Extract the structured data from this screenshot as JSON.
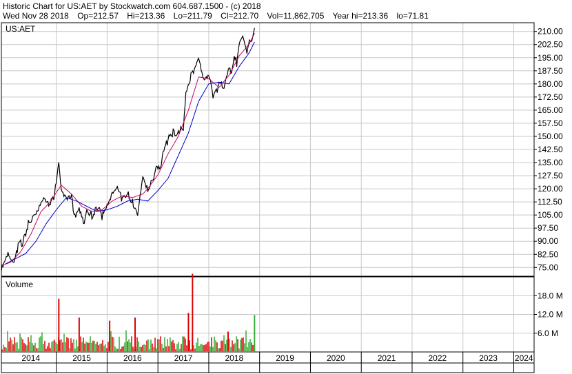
{
  "header": {
    "line1": "Historic Chart for US:AET by Stockwatch.com 604.687.1500 - (c) 2018",
    "date": "Wed Nov 28 2018",
    "open": "Op=212.57",
    "high": "Hi=213.36",
    "low": "Lo=211.79",
    "close": "Cl=212.70",
    "volume": "Vol=11,862,705",
    "year_high": "Year hi=213.36",
    "year_low": "lo=71.81"
  },
  "colors": {
    "price": "#000000",
    "ma_short": "#cc0066",
    "ma_long": "#0000cc",
    "vol_up": "#33aa33",
    "vol_down": "#dd0000",
    "grid": "#c8c8c8"
  },
  "chart_data": [
    {
      "type": "line",
      "title": "US:AET",
      "ylim": [
        70,
        215
      ],
      "y_ticks": [
        "210.00",
        "202.50",
        "195.00",
        "187.50",
        "180.00",
        "172.50",
        "165.00",
        "157.50",
        "150.00",
        "142.50",
        "135.00",
        "127.50",
        "120.00",
        "112.50",
        "105.00",
        "97.50",
        "90.00",
        "82.50",
        "75.00"
      ],
      "x_ticks": [
        "2014",
        "2015",
        "2016",
        "2017",
        "2018",
        "2019",
        "2020",
        "2021",
        "2022",
        "2023",
        "2024"
      ],
      "xlim": [
        2013.92,
        2024.4
      ],
      "series": [
        {
          "x": [
            2013.92,
            2014.05,
            2014.15,
            2014.25,
            2014.35,
            2014.45,
            2014.55,
            2014.65,
            2014.75,
            2014.85,
            2014.95,
            2015.0,
            2015.05,
            2015.1,
            2015.2,
            2015.3,
            2015.35,
            2015.45,
            2015.55,
            2015.6,
            2015.7,
            2015.8,
            2015.9,
            2016.0,
            2016.1,
            2016.2,
            2016.3,
            2016.4,
            2016.5,
            2016.6,
            2016.7,
            2016.8,
            2016.9,
            2016.95,
            2017.0,
            2017.05,
            2017.1,
            2017.2,
            2017.3,
            2017.4,
            2017.45,
            2017.5,
            2017.55,
            2017.6,
            2017.7,
            2017.8,
            2017.9,
            2018.0,
            2018.1,
            2018.2,
            2018.25,
            2018.3,
            2018.35,
            2018.4,
            2018.45,
            2018.5,
            2018.55,
            2018.6,
            2018.65,
            2018.7,
            2018.75,
            2018.8,
            2018.85,
            2018.9
          ],
          "values": [
            73,
            82,
            76,
            87,
            90,
            100,
            105,
            110,
            116,
            112,
            115,
            124,
            133,
            118,
            113,
            116,
            103,
            110,
            101,
            108,
            105,
            110,
            104,
            109,
            116,
            120,
            114,
            117,
            113,
            107,
            128,
            120,
            125,
            133,
            131,
            130,
            140,
            148,
            153,
            152,
            157,
            155,
            176,
            180,
            188,
            193,
            181,
            184,
            172,
            180,
            181,
            178,
            185,
            190,
            187,
            196,
            192,
            201,
            206,
            203,
            197,
            205,
            207,
            212
          ]
        },
        {
          "x": [
            2013.92,
            2014.1,
            2014.3,
            2014.5,
            2014.7,
            2014.9,
            2015.0,
            2015.1,
            2015.3,
            2015.5,
            2015.7,
            2015.9,
            2016.1,
            2016.3,
            2016.5,
            2016.7,
            2016.8,
            2017.0,
            2017.2,
            2017.4,
            2017.6,
            2017.8,
            2018.0,
            2018.2,
            2018.4,
            2018.6,
            2018.8,
            2018.9
          ],
          "values": [
            76,
            78,
            84,
            94,
            107,
            113,
            118,
            122,
            117,
            110,
            107,
            108,
            113,
            116,
            115,
            117,
            120,
            128,
            140,
            150,
            165,
            184,
            183,
            178,
            185,
            196,
            203,
            209
          ]
        },
        {
          "x": [
            2014.0,
            2014.2,
            2014.4,
            2014.6,
            2014.8,
            2015.0,
            2015.2,
            2015.4,
            2015.6,
            2015.8,
            2016.0,
            2016.2,
            2016.4,
            2016.6,
            2016.8,
            2017.0,
            2017.2,
            2017.4,
            2017.6,
            2017.8,
            2018.0,
            2018.2,
            2018.4,
            2018.6,
            2018.8,
            2018.9
          ],
          "values": [
            77,
            80,
            83,
            90,
            100,
            108,
            115,
            113,
            110,
            107,
            108,
            110,
            113,
            114,
            113,
            119,
            126,
            139,
            152,
            170,
            180,
            181,
            180,
            190,
            198,
            204
          ]
        }
      ]
    },
    {
      "type": "bar",
      "title": "Volume",
      "ylim": [
        0,
        24
      ],
      "y_ticks": [
        "18.0 M",
        "12.0 M",
        "6.0 M"
      ],
      "series": [
        {
          "x": [
            2015.05,
            2015.45,
            2016.05,
            2016.55,
            2017.6,
            2017.68,
            2018.38,
            2018.9
          ],
          "values": [
            17,
            11,
            10,
            11,
            12.5,
            25,
            6.5,
            11.8
          ]
        }
      ]
    }
  ]
}
